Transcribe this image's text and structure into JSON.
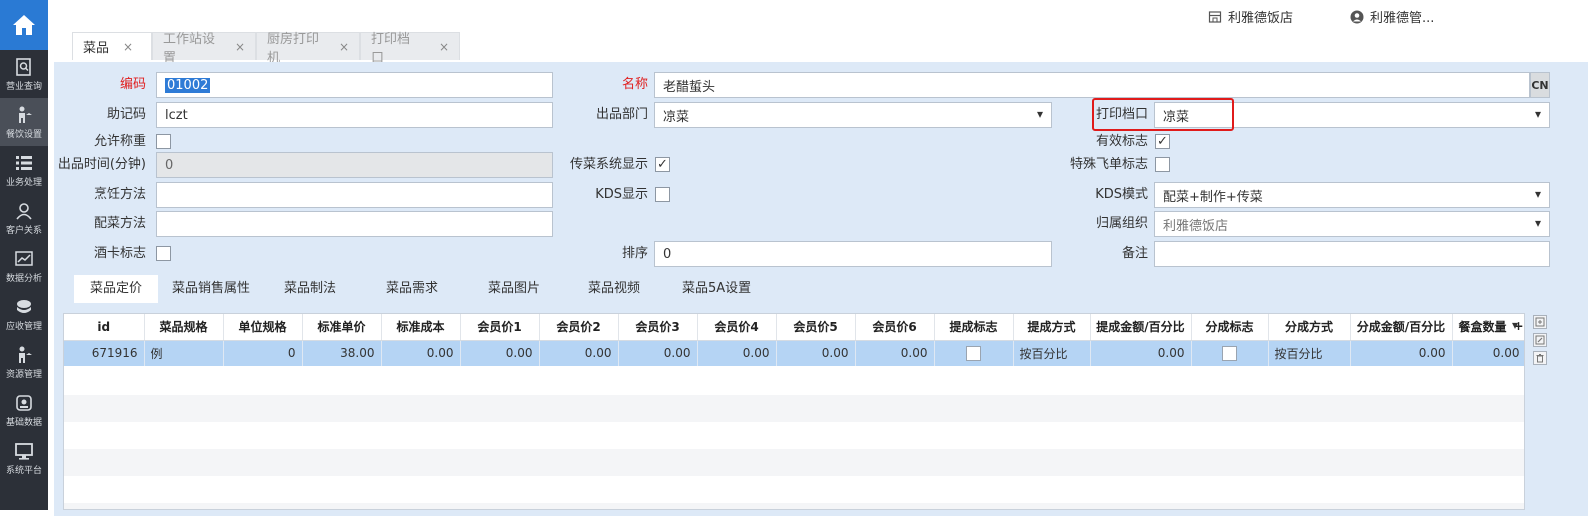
{
  "sidebar": {
    "items": [
      {
        "label": "营业查询",
        "icon": "search-report-icon"
      },
      {
        "label": "餐饮设置",
        "icon": "waiter-icon"
      },
      {
        "label": "业务处理",
        "icon": "list-icon"
      },
      {
        "label": "客户关系",
        "icon": "users-icon"
      },
      {
        "label": "数据分析",
        "icon": "chart-icon"
      },
      {
        "label": "应收管理",
        "icon": "money-icon"
      },
      {
        "label": "资源管理",
        "icon": "waiter-icon"
      },
      {
        "label": "基础数据",
        "icon": "database-icon"
      },
      {
        "label": "系统平台",
        "icon": "monitor-icon"
      }
    ],
    "active_index": 1
  },
  "header": {
    "store": "利雅德饭店",
    "user": "利雅德管..."
  },
  "tabs": [
    {
      "label": "菜品",
      "close": "×"
    },
    {
      "label": "工作站设置",
      "close": "×"
    },
    {
      "label": "厨房打印机",
      "close": "×"
    },
    {
      "label": "打印档口",
      "close": "×"
    }
  ],
  "form": {
    "code_label": "编码",
    "code_value": "01002",
    "name_label": "名称",
    "name_value": "老醋蜇头",
    "cn_label": "CN",
    "mnemonic_label": "助记码",
    "mnemonic_value": "lczt",
    "dept_label": "出品部门",
    "dept_value": "凉菜",
    "print_label": "打印档口",
    "print_value": "凉菜",
    "weigh_label": "允许称重",
    "valid_label": "有效标志",
    "valid_checked": "✓",
    "time_label": "出品时间(分钟)",
    "time_value": "0",
    "pass_label": "传菜系统显示",
    "pass_checked": "✓",
    "fly_label": "特殊飞单标志",
    "cook_label": "烹饪方法",
    "kds_label": "KDS显示",
    "kds_mode_label": "KDS模式",
    "kds_mode_value": "配菜+制作+传菜",
    "side_label": "配菜方法",
    "org_label": "归属组织",
    "org_value": "利雅德饭店",
    "wine_label": "酒卡标志",
    "sort_label": "排序",
    "sort_value": "0",
    "remark_label": "备注"
  },
  "subtabs": [
    "菜品定价",
    "菜品销售属性",
    "菜品制法",
    "菜品需求",
    "菜品图片",
    "菜品视频",
    "菜品5A设置"
  ],
  "grid": {
    "headers": [
      "id",
      "菜品规格",
      "单位规格",
      "标准单价",
      "标准成本",
      "会员价1",
      "会员价2",
      "会员价3",
      "会员价4",
      "会员价5",
      "会员价6",
      "提成标志",
      "提成方式",
      "提成金额/百分比",
      "分成标志",
      "分成方式",
      "分成金额/百分比",
      "餐盒数量"
    ],
    "rows": [
      {
        "id": "671916",
        "spec": "例",
        "unit": "0",
        "price": "38.00",
        "cost": "0.00",
        "m1": "0.00",
        "m2": "0.00",
        "m3": "0.00",
        "m4": "0.00",
        "m5": "0.00",
        "m6": "0.00",
        "comm_mode": "按百分比",
        "comm_amt": "0.00",
        "share_mode": "按百分比",
        "share_amt": "0.00",
        "box": "0.00"
      }
    ],
    "add_glyph": "+"
  }
}
